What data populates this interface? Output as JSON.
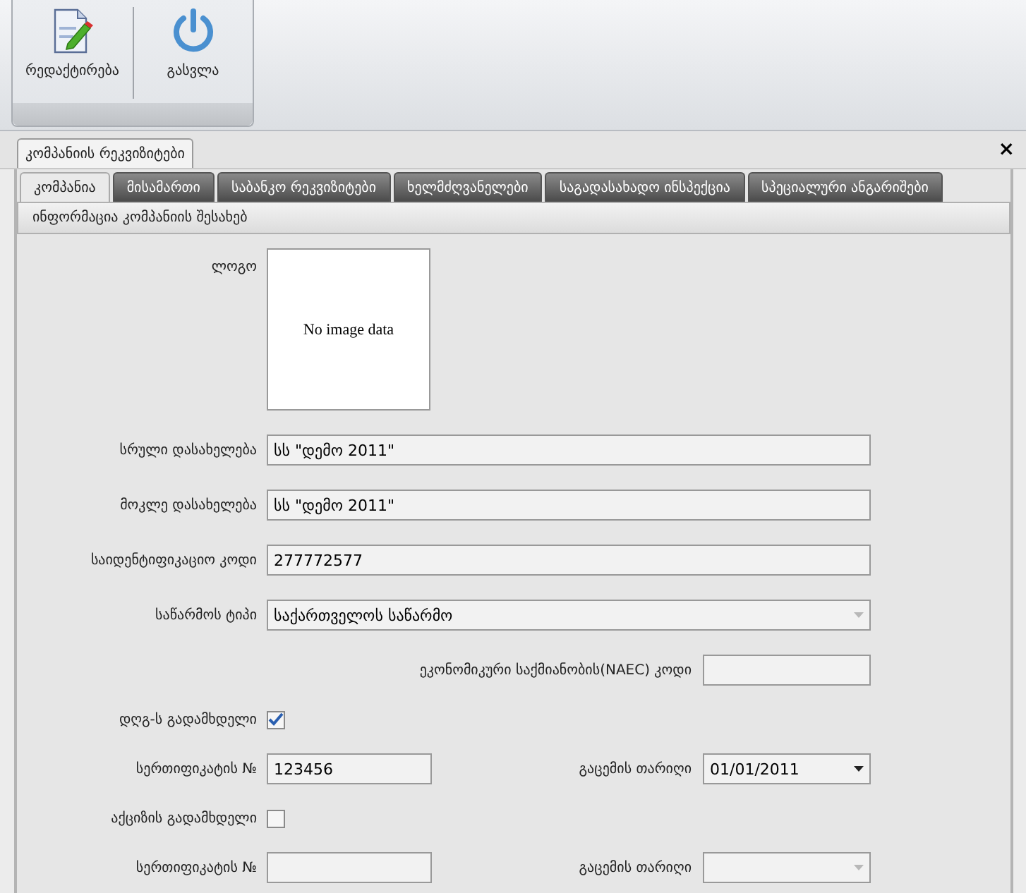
{
  "ribbon": {
    "buttons": [
      {
        "kind": "edit",
        "label": "რედაქტირება"
      },
      {
        "kind": "exit",
        "label": "გასვლა"
      }
    ]
  },
  "document_tabs": [
    {
      "label": "კომპანიის რეკვიზიტები",
      "selected": true
    }
  ],
  "close": "×",
  "tabs": [
    {
      "label": "კომპანია",
      "selected": true
    },
    {
      "label": "მისამართი",
      "selected": false
    },
    {
      "label": "საბანკო რეკვიზიტები",
      "selected": false
    },
    {
      "label": "ხელმძღვანელები",
      "selected": false
    },
    {
      "label": "საგადასახადო ინსპექცია",
      "selected": false
    },
    {
      "label": "სპეციალური ანგარიშები",
      "selected": false
    }
  ],
  "section": "ინფორმაცია კომპანიის შესახებ",
  "rows": [
    {
      "kind": "image",
      "label": "ლოგო",
      "placeholder": "No image data"
    },
    {
      "kind": "text",
      "label": "სრული დასახელება",
      "value": "სს \"დემო 2011\""
    },
    {
      "kind": "text",
      "label": "მოკლე დასახელება",
      "value": "სს \"დემო 2011\""
    },
    {
      "kind": "text",
      "label": "საიდენტიფიკაციო კოდი",
      "value": "277772577"
    },
    {
      "kind": "select",
      "label": "საწარმოს ტიპი",
      "value": "საქართველოს საწარმო"
    },
    {
      "kind": "short_right",
      "label": "ეკონომიკური საქმიანობის(NAEC) კოდი"
    },
    {
      "kind": "checkbox",
      "label": "დღგ-ს გადამხდელი",
      "checked": true
    },
    {
      "kind": "pair",
      "label": "სერთიფიკატის №",
      "value": "123456",
      "date_label": "გაცემის თარიღი",
      "date_value": "01/01/2011"
    },
    {
      "kind": "checkbox",
      "label": "აქციზის გადამხდელი",
      "checked": false
    },
    {
      "kind": "pair",
      "label": "სერთიფიკატის №",
      "date_label": "გაცემის თარიღი"
    }
  ]
}
